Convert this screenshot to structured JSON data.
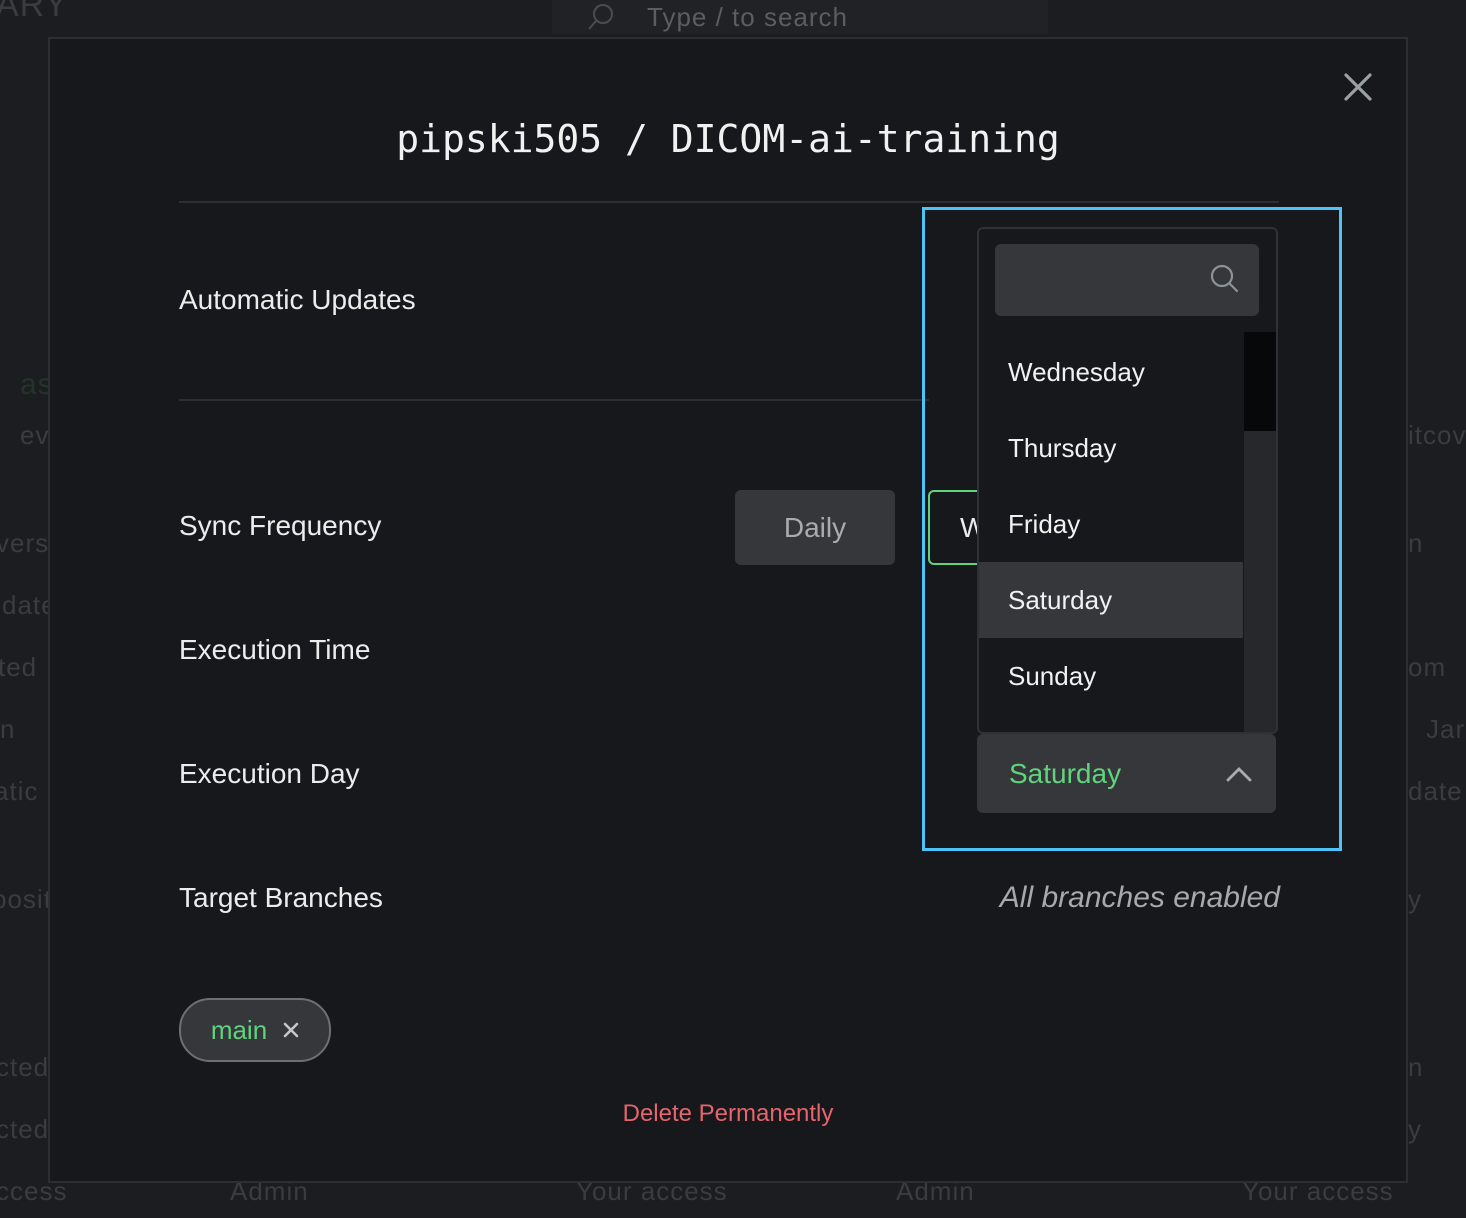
{
  "background": {
    "search_placeholder": "Type / to search",
    "fragments_left": [
      "ARY",
      "as",
      "ev",
      "vers",
      "date",
      "ted",
      "n",
      "atic u",
      "posit",
      "cted",
      "cted",
      "ccess"
    ],
    "fragments_right": [
      "itcov",
      "n",
      "om",
      "Jar",
      "date",
      "y",
      "n",
      "y"
    ],
    "footer": [
      "Admin",
      "Your access",
      "Admin",
      "Your access"
    ]
  },
  "modal": {
    "title": "pipski505 / DICOM-ai-training",
    "close_icon": "close-icon",
    "rows": {
      "automatic_updates": "Automatic Updates",
      "sync_frequency": "Sync Frequency",
      "execution_time": "Execution Time",
      "execution_day": "Execution Day",
      "target_branches": "Target Branches"
    },
    "frequency_options": [
      "Daily",
      "W"
    ],
    "frequency_selected": "W",
    "branches_status": "All branches enabled",
    "branch_chips": [
      {
        "label": "main",
        "remove_icon": "close-icon"
      }
    ],
    "delete_label": "Delete Permanently"
  },
  "dropdown": {
    "search_value": "",
    "search_icon": "search-icon",
    "options": [
      "Wednesday",
      "Thursday",
      "Friday",
      "Saturday",
      "Sunday"
    ],
    "highlighted": "Saturday",
    "selected": "Saturday",
    "chevron_icon": "chevron-up-icon"
  },
  "colors": {
    "accent_green": "#5fd47c",
    "danger": "#e5646d",
    "focus": "#4fc3f7"
  }
}
